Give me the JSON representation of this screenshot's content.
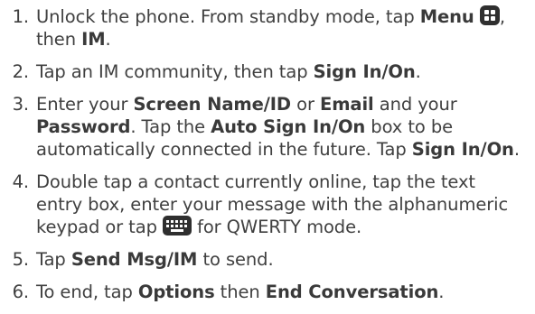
{
  "steps": [
    {
      "number": "1.",
      "parts": [
        {
          "t": "Unlock the phone. From standby mode, tap "
        },
        {
          "t": "Menu",
          "b": true
        },
        {
          "t": " "
        },
        {
          "icon": "menu-grid-icon"
        },
        {
          "t": ", then "
        },
        {
          "t": "IM",
          "b": true
        },
        {
          "t": "."
        }
      ]
    },
    {
      "number": "2.",
      "parts": [
        {
          "t": "Tap an IM community, then tap "
        },
        {
          "t": "Sign In/On",
          "b": true
        },
        {
          "t": "."
        }
      ]
    },
    {
      "number": "3.",
      "parts": [
        {
          "t": "Enter your "
        },
        {
          "t": "Screen Name/ID",
          "b": true
        },
        {
          "t": " or "
        },
        {
          "t": "Email",
          "b": true
        },
        {
          "t": " and your "
        },
        {
          "t": "Password",
          "b": true
        },
        {
          "t": ". Tap the "
        },
        {
          "t": "Auto Sign In/On",
          "b": true
        },
        {
          "t": " box to be automatically connected in the future. Tap "
        },
        {
          "t": "Sign In/On",
          "b": true
        },
        {
          "t": "."
        }
      ]
    },
    {
      "number": "4.",
      "parts": [
        {
          "t": "Double tap a contact currently online, tap the text entry box, enter your message with the alphanumeric keypad or tap "
        },
        {
          "icon": "keyboard-icon"
        },
        {
          "t": " for QWERTY mode."
        }
      ]
    },
    {
      "number": "5.",
      "parts": [
        {
          "t": "Tap "
        },
        {
          "t": "Send Msg/IM",
          "b": true
        },
        {
          "t": " to send."
        }
      ]
    },
    {
      "number": "6.",
      "parts": [
        {
          "t": "To end, tap "
        },
        {
          "t": "Options",
          "b": true
        },
        {
          "t": " then "
        },
        {
          "t": "End Conversation",
          "b": true
        },
        {
          "t": "."
        }
      ]
    }
  ],
  "colors": {
    "text": "#404040",
    "icon_bg": "#2f2f2f",
    "icon_fg": "#ffffff"
  }
}
